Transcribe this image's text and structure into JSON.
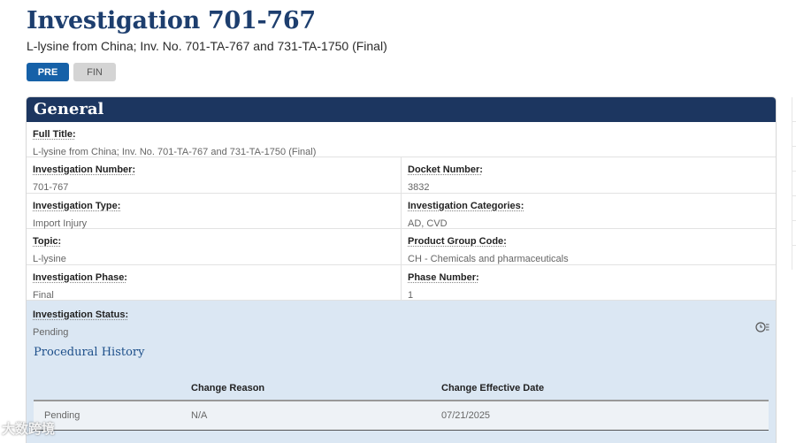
{
  "page": {
    "title": "Investigation 701-767",
    "subtitle": "L-lysine from China; Inv. No. 701-TA-767 and 731-TA-1750 (Final)"
  },
  "phase_tabs": [
    {
      "label": "PRE",
      "active": true
    },
    {
      "label": "FIN",
      "active": false
    }
  ],
  "general": {
    "header": "General",
    "full_title": {
      "label": "Full Title:",
      "value": "L-lysine from China; Inv. No. 701-TA-767 and 731-TA-1750 (Final)"
    },
    "investigation_number": {
      "label": "Investigation Number:",
      "value": "701-767"
    },
    "docket_number": {
      "label": "Docket Number:",
      "value": "3832"
    },
    "investigation_type": {
      "label": "Investigation Type:",
      "value": "Import Injury"
    },
    "investigation_categories": {
      "label": "Investigation Categories:",
      "value": "AD, CVD"
    },
    "topic": {
      "label": "Topic:",
      "value": "L-lysine"
    },
    "product_group_code": {
      "label": "Product Group Code:",
      "value": "CH - Chemicals and pharmaceuticals"
    },
    "investigation_phase": {
      "label": "Investigation Phase:",
      "value": "Final"
    },
    "phase_number": {
      "label": "Phase Number:",
      "value": "1"
    },
    "investigation_status": {
      "label": "Investigation Status:",
      "value": "Pending"
    }
  },
  "procedural_history": {
    "title": "Procedural History",
    "columns": [
      "",
      "Change Reason",
      "Change Effective Date"
    ],
    "rows": [
      {
        "status": "Pending",
        "reason": "N/A",
        "date": "07/21/2025"
      }
    ]
  },
  "icons": {
    "history": "history-list-icon"
  },
  "watermark": "大数跨境",
  "colors": {
    "title": "#1d3e6e",
    "header_bg": "#1c3660",
    "active_tab": "#1661a8",
    "status_bg": "#dbe7f3"
  }
}
